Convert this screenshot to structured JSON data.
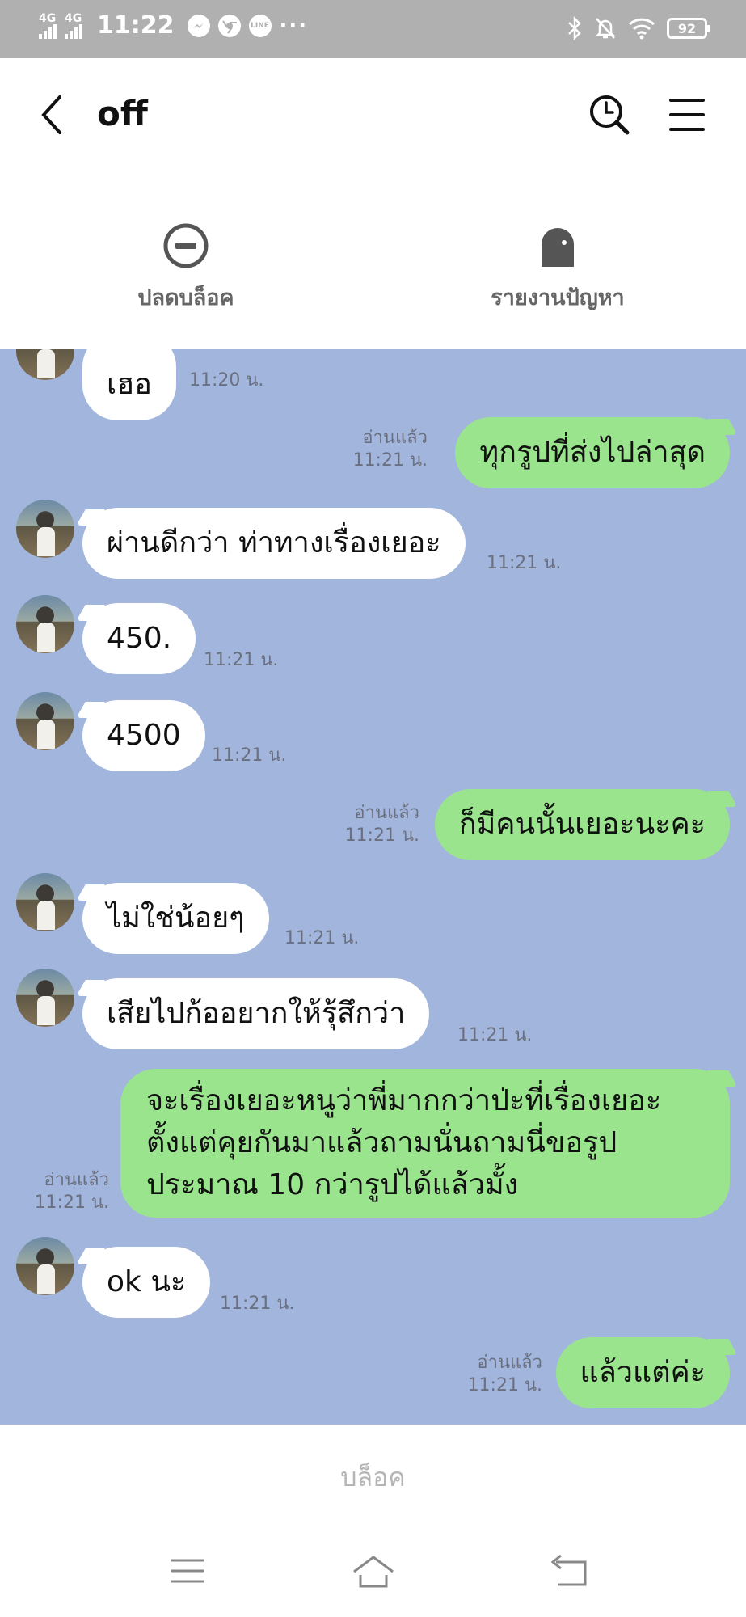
{
  "status_bar": {
    "network_1": "4G",
    "network_2": "4G",
    "time": "11:22",
    "more": "···",
    "battery": "92",
    "icons": [
      "signal-icon",
      "messenger-icon",
      "chrome-icon",
      "line-icon",
      "bluetooth-icon",
      "bell-off-icon",
      "wifi-icon",
      "battery-icon"
    ]
  },
  "header": {
    "title": "off",
    "icons": [
      "back-arrow-icon",
      "search-icon",
      "menu-icon"
    ]
  },
  "actions": {
    "unblock_label": "ปลดบล็อค",
    "report_label": "รายงานปัญหา"
  },
  "messages": [
    {
      "side": "in",
      "text": "เฮอ",
      "time": "11:20 น."
    },
    {
      "side": "out",
      "text": "ทุกรูปที่ส่งไปล่าสุด",
      "read": "อ่านแล้ว",
      "time": "11:21 น."
    },
    {
      "side": "in",
      "text": "ผ่านดีกว่า ท่าทางเรื่องเยอะ",
      "time": "11:21 น."
    },
    {
      "side": "in",
      "text": "450.",
      "time": "11:21 น."
    },
    {
      "side": "in",
      "text": "4500",
      "time": "11:21 น."
    },
    {
      "side": "out",
      "text": "ก็มีคนนั้นเยอะนะคะ",
      "read": "อ่านแล้ว",
      "time": "11:21 น."
    },
    {
      "side": "in",
      "text": "ไม่ใช่น้อยๆ",
      "time": "11:21 น."
    },
    {
      "side": "in",
      "text": "เสียไปก้ออยากให้รุ้สึกว่า",
      "time": "11:21 น."
    },
    {
      "side": "out",
      "lines": [
        "จะเรื่องเยอะหนูว่าพี่มากกว่าป่ะที่เรื่องเยอะ",
        "ตั้งแต่คุยกันมาแล้วถามนั่นถามนี่ขอรูป",
        "ประมาณ 10 กว่ารูปได้แล้วมั้ง"
      ],
      "read": "อ่านแล้ว",
      "time": "11:21 น."
    },
    {
      "side": "in",
      "text": "ok นะ",
      "time": "11:21 น."
    },
    {
      "side": "out",
      "text": "แล้วแต่ค่ะ",
      "read": "อ่านแล้ว",
      "time": "11:21 น."
    }
  ],
  "bottom": {
    "block_label": "บล็อค"
  },
  "nav": {
    "icons": [
      "recent-apps-icon",
      "home-icon",
      "back-icon"
    ]
  }
}
